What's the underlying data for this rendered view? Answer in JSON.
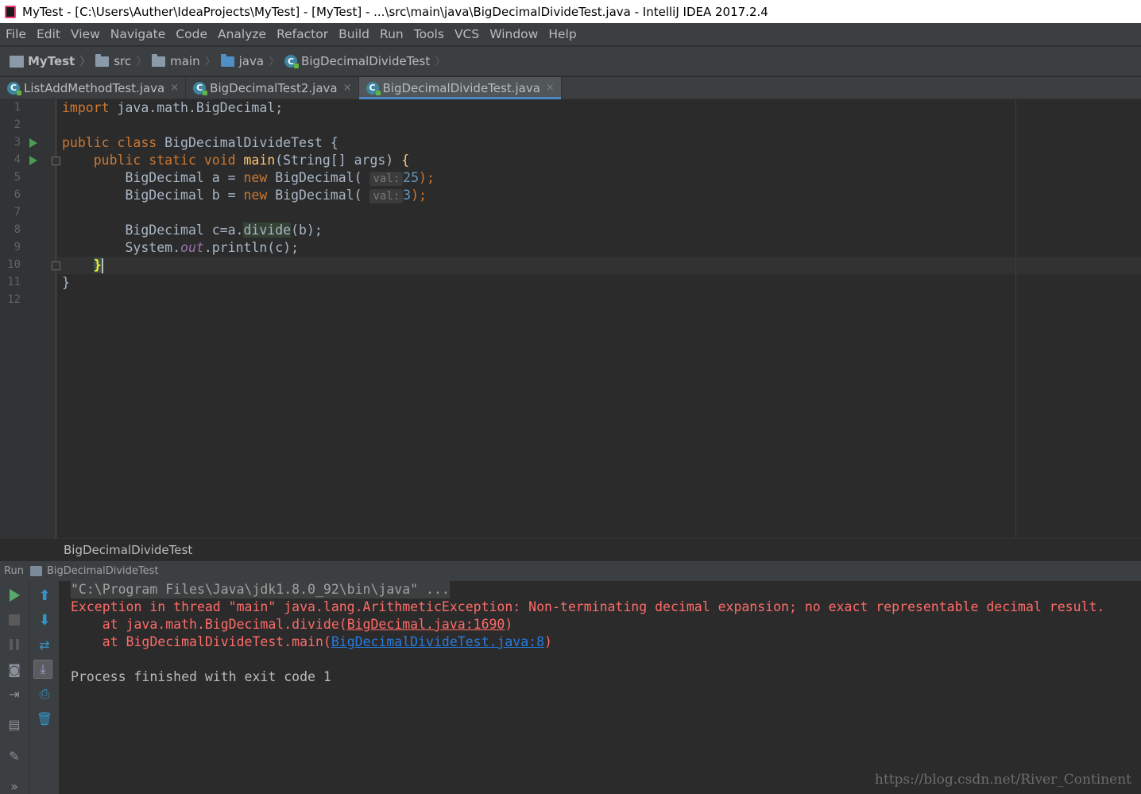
{
  "window": {
    "title": "MyTest - [C:\\Users\\Auther\\IdeaProjects\\MyTest] - [MyTest] - ...\\src\\main\\java\\BigDecimalDivideTest.java - IntelliJ IDEA 2017.2.4"
  },
  "menu": [
    "File",
    "Edit",
    "View",
    "Navigate",
    "Code",
    "Analyze",
    "Refactor",
    "Build",
    "Run",
    "Tools",
    "VCS",
    "Window",
    "Help"
  ],
  "breadcrumbs": {
    "project": "MyTest",
    "src": "src",
    "main": "main",
    "java": "java",
    "class": "BigDecimalDivideTest"
  },
  "tabs": [
    {
      "label": "ListAddMethodTest.java",
      "close": "×"
    },
    {
      "label": "BigDecimalTest2.java",
      "close": "×"
    },
    {
      "label": "BigDecimalDivideTest.java",
      "close": "×"
    }
  ],
  "line_numbers": [
    "1",
    "2",
    "3",
    "4",
    "5",
    "6",
    "7",
    "8",
    "9",
    "10",
    "11",
    "12"
  ],
  "code": {
    "l1_kw": "import",
    "l1_rest": " java.math.BigDecimal;",
    "l3_kw1": "public",
    "l3_kw2": " class",
    "l3_rest": " BigDecimalDivideTest {",
    "l4_indent": "    ",
    "l4_kw": "public static void",
    "l4_fn": " main",
    "l4_rest": "(String[] args) ",
    "l4_brace": "{",
    "l5_pre": "        BigDecimal a = ",
    "l5_new": "new",
    "l5_mid": " BigDecimal( ",
    "l5_hint": "val:",
    "l5_num": "25",
    "l5_end": ");",
    "l6_pre": "        BigDecimal b = ",
    "l6_new": "new",
    "l6_mid": " BigDecimal( ",
    "l6_hint": "val:",
    "l6_num": "3",
    "l6_end": ");",
    "l8_pre": "        BigDecimal c=a.",
    "l8_method": "divide",
    "l8_end": "(b);",
    "l9_pre": "        System.",
    "l9_static": "out",
    "l9_end": ".println(c);",
    "l10_indent": "    ",
    "l10_brace": "}",
    "l11": "}"
  },
  "editor_breadcrumb": "BigDecimalDivideTest",
  "run_panel": {
    "label": "Run",
    "config": "BigDecimalDivideTest"
  },
  "console": {
    "cmd": "\"C:\\Program Files\\Java\\jdk1.8.0_92\\bin\\java\" ...",
    "exception": "Exception in thread \"main\" java.lang.ArithmeticException: Non-terminating decimal expansion; no exact representable decimal result.",
    "trace1_pre": "    at java.math.BigDecimal.divide(",
    "trace1_link": "BigDecimal.java:1690",
    "trace1_post": ")",
    "trace2_pre": "    at BigDecimalDivideTest.main(",
    "trace2_link": "BigDecimalDivideTest.java:8",
    "trace2_post": ")",
    "exit": "Process finished with exit code 1"
  },
  "watermark": "https://blog.csdn.net/River_Continent",
  "colors": {
    "background": "#2b2b2b",
    "keyword": "#cc7832",
    "function": "#ffc66d",
    "number": "#6897bb",
    "error": "#ff6b68",
    "link": "#287bde"
  }
}
